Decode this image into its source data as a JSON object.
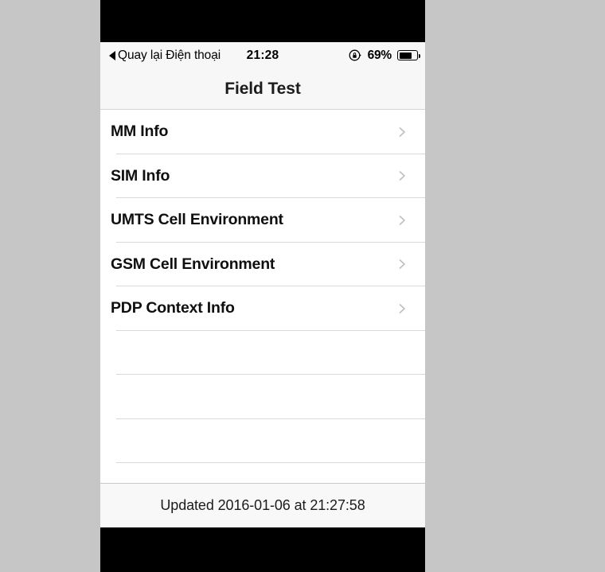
{
  "theme": {
    "page_background": "#c6c6c6",
    "screen_background": "#ffffff",
    "bar_background": "#f7f7f7",
    "separator": "#d9d9d9",
    "text_primary": "#0f0f0f",
    "chevron": "#c0c0c0"
  },
  "status_bar": {
    "back_label": "Quay lại Điện thoại",
    "back_icon": "back-triangle-icon",
    "time": "21:28",
    "rotation_lock_icon": "rotation-lock-icon",
    "battery_percent": "69%",
    "battery_level": 69,
    "battery_icon": "battery-icon"
  },
  "nav_bar": {
    "title": "Field Test"
  },
  "list": {
    "rows": [
      {
        "label": "MM Info",
        "accessory": "chevron-right-icon"
      },
      {
        "label": "SIM Info",
        "accessory": "chevron-right-icon"
      },
      {
        "label": "UMTS Cell Environment",
        "accessory": "chevron-right-icon"
      },
      {
        "label": "GSM Cell Environment",
        "accessory": "chevron-right-icon"
      },
      {
        "label": "PDP Context Info",
        "accessory": "chevron-right-icon"
      }
    ],
    "empty_row_count": 4
  },
  "footer": {
    "text": "Updated 2016-01-06 at 21:27:58"
  }
}
